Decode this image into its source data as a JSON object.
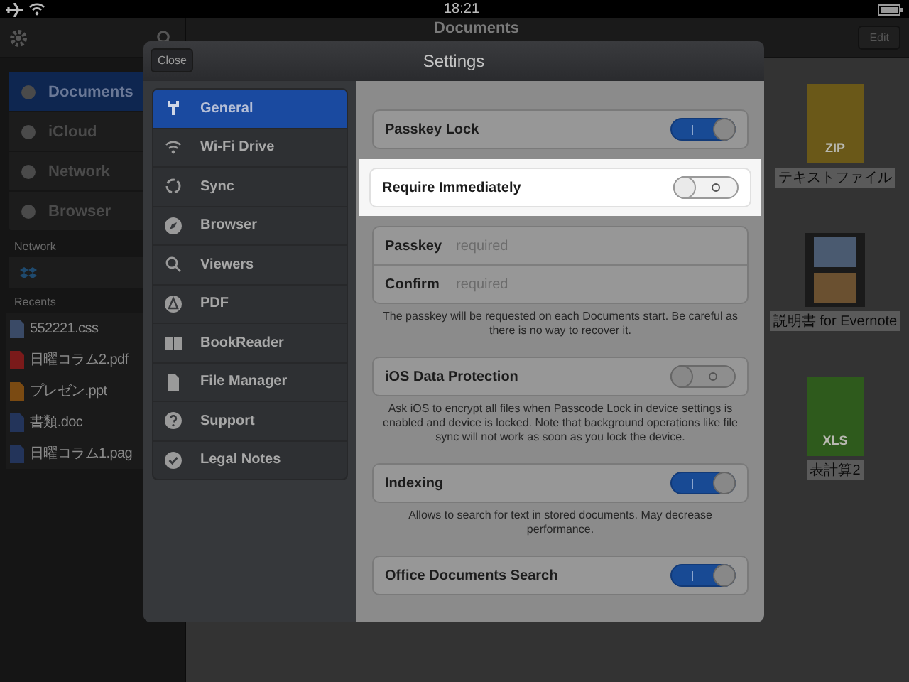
{
  "status_bar": {
    "time": "18:21"
  },
  "background_app": {
    "title": "Documents",
    "edit_button": "Edit",
    "sidebar": {
      "items": [
        {
          "label": "Documents",
          "selected": true
        },
        {
          "label": "iCloud",
          "selected": false
        },
        {
          "label": "Network",
          "selected": false
        },
        {
          "label": "Browser",
          "selected": false
        }
      ],
      "network_section": {
        "title": "Network"
      },
      "recents_section": {
        "title": "Recents",
        "files": [
          {
            "name": "552221.css",
            "kind": "css"
          },
          {
            "name": "日曜コラム2.pdf",
            "kind": "pdf"
          },
          {
            "name": "プレゼン.ppt",
            "kind": "ppt"
          },
          {
            "name": "書類.doc",
            "kind": "doc"
          },
          {
            "name": "日曜コラム1.pag",
            "kind": "doc"
          }
        ]
      }
    },
    "files": [
      {
        "name": "テキストファイル",
        "kind": "zip",
        "badge": "ZIP"
      },
      {
        "name": "説明書 for Evernote",
        "kind": "video"
      },
      {
        "name": "表計算2",
        "kind": "xls",
        "badge": "XLS"
      }
    ]
  },
  "settings": {
    "close_button": "Close",
    "title": "Settings",
    "nav_items": [
      {
        "label": "General",
        "selected": true
      },
      {
        "label": "Wi-Fi Drive",
        "selected": false
      },
      {
        "label": "Sync",
        "selected": false
      },
      {
        "label": "Browser",
        "selected": false
      },
      {
        "label": "Viewers",
        "selected": false
      },
      {
        "label": "PDF",
        "selected": false
      },
      {
        "label": "BookReader",
        "selected": false
      },
      {
        "label": "File Manager",
        "selected": false
      },
      {
        "label": "Support",
        "selected": false
      },
      {
        "label": "Legal Notes",
        "selected": false
      }
    ],
    "groups": [
      {
        "kind": "toggle",
        "label": "Passkey Lock",
        "on": true,
        "highlighted": false
      },
      {
        "kind": "toggle",
        "label": "Require Immediately",
        "on": false,
        "highlighted": true
      },
      {
        "kind": "fields",
        "rows": [
          {
            "label": "Passkey",
            "placeholder": "required"
          },
          {
            "label": "Confirm",
            "placeholder": "required"
          }
        ]
      },
      {
        "kind": "note",
        "text": "The passkey will be requested on each Documents start. Be careful as there is no way to recover it."
      },
      {
        "kind": "toggle",
        "label": "iOS Data Protection",
        "on": false,
        "highlighted": false
      },
      {
        "kind": "note",
        "text": "Ask iOS to encrypt all files when Passcode Lock in device settings is enabled and device is locked. Note that background operations like file sync will not work as soon as you lock the device."
      },
      {
        "kind": "toggle",
        "label": "Indexing",
        "on": true,
        "highlighted": false
      },
      {
        "kind": "note",
        "text": "Allows to search for text in stored documents. May decrease performance."
      },
      {
        "kind": "toggle",
        "label": "Office Documents Search",
        "on": true,
        "highlighted": false
      }
    ]
  }
}
